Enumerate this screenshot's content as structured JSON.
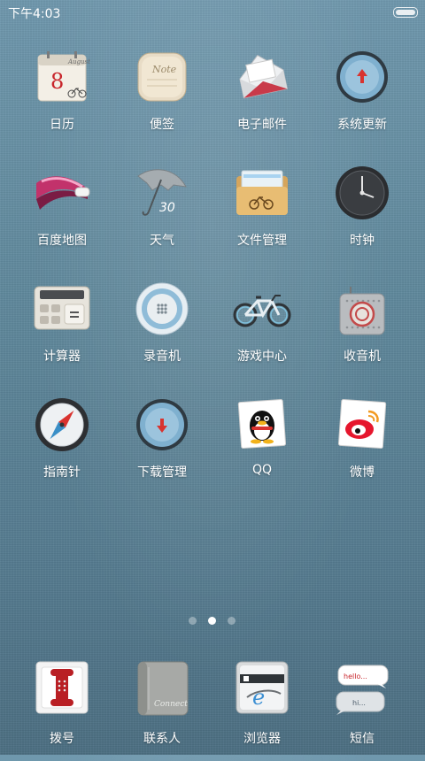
{
  "status": {
    "time": "下午4:03"
  },
  "apps": [
    {
      "label": "日历",
      "icon": "calendar-icon",
      "calendar": {
        "month": "August",
        "day": "8"
      }
    },
    {
      "label": "便签",
      "icon": "notes-icon",
      "note_title": "Note"
    },
    {
      "label": "电子邮件",
      "icon": "email-icon"
    },
    {
      "label": "系统更新",
      "icon": "system-update-icon"
    },
    {
      "label": "百度地图",
      "icon": "baidu-map-icon"
    },
    {
      "label": "天气",
      "icon": "weather-umbrella-icon",
      "temperature": "30"
    },
    {
      "label": "文件管理",
      "icon": "file-manager-icon"
    },
    {
      "label": "时钟",
      "icon": "clock-icon"
    },
    {
      "label": "计算器",
      "icon": "calculator-icon"
    },
    {
      "label": "录音机",
      "icon": "recorder-icon"
    },
    {
      "label": "游戏中心",
      "icon": "bicycle-game-center-icon"
    },
    {
      "label": "收音机",
      "icon": "radio-icon"
    },
    {
      "label": "指南针",
      "icon": "compass-icon"
    },
    {
      "label": "下载管理",
      "icon": "download-manager-icon"
    },
    {
      "label": "QQ",
      "icon": "qq-penguin-icon"
    },
    {
      "label": "微博",
      "icon": "weibo-icon"
    }
  ],
  "pager": {
    "pages": 3,
    "current": 2
  },
  "dock": [
    {
      "label": "拨号",
      "icon": "phone-dialer-icon"
    },
    {
      "label": "联系人",
      "icon": "contacts-icon",
      "cover_text": "Connect"
    },
    {
      "label": "浏览器",
      "icon": "browser-icon"
    },
    {
      "label": "短信",
      "icon": "messages-icon",
      "bubble1": "hello...",
      "bubble2": "hi..."
    }
  ],
  "colors": {
    "wallpaper_top": "#6f98ad",
    "wallpaper_bottom": "#4c6f82",
    "label_text": "#ffffff",
    "accent_red": "#c8252b"
  }
}
